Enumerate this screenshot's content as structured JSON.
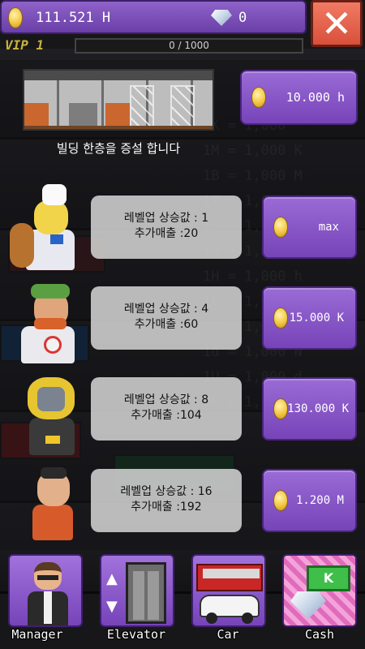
{
  "header": {
    "money": "111.521 H",
    "gems": "0",
    "vip_label": "VIP 1",
    "vip_progress_text": "0 / 1000",
    "vip_progress": 0
  },
  "build": {
    "caption": "빌딩 한층을 증설 합니다",
    "cost": "10.000 h"
  },
  "upgrades": [
    {
      "line1": "레벨업 상승값 : 1",
      "line2": "추가매출 :20",
      "cost": "max"
    },
    {
      "line1": "레벨업 상승값 : 4",
      "line2": "추가매출 :60",
      "cost": "15.000 K"
    },
    {
      "line1": "레벨업 상승값 : 8",
      "line2": "추가매출 :104",
      "cost": "130.000 K"
    },
    {
      "line1": "레벨업 상승값 : 16",
      "line2": "추가매출 :192",
      "cost": "1.200 M"
    }
  ],
  "background_table": [
    "1K  =  1,000",
    "1M  =  1,000 K",
    "1B  =  1,000 M",
    "1T  =  1,000 B",
    "1Q  =  1,000 T",
    "1h  =  1,000 Q",
    "1H  =  1,000 h",
    "1C  =  1,000 H",
    "1N  =  1,000 C",
    "1d  =  1,000 N",
    "1U  =  1,000 d",
    "1D  =  1,000 U"
  ],
  "nav": {
    "manager": "Manager",
    "elevator": "Elevator",
    "car": "Car",
    "cash": "Cash"
  },
  "colors": {
    "accent": "#7744b8",
    "close": "#d9503b",
    "coin": "#f3c640"
  }
}
